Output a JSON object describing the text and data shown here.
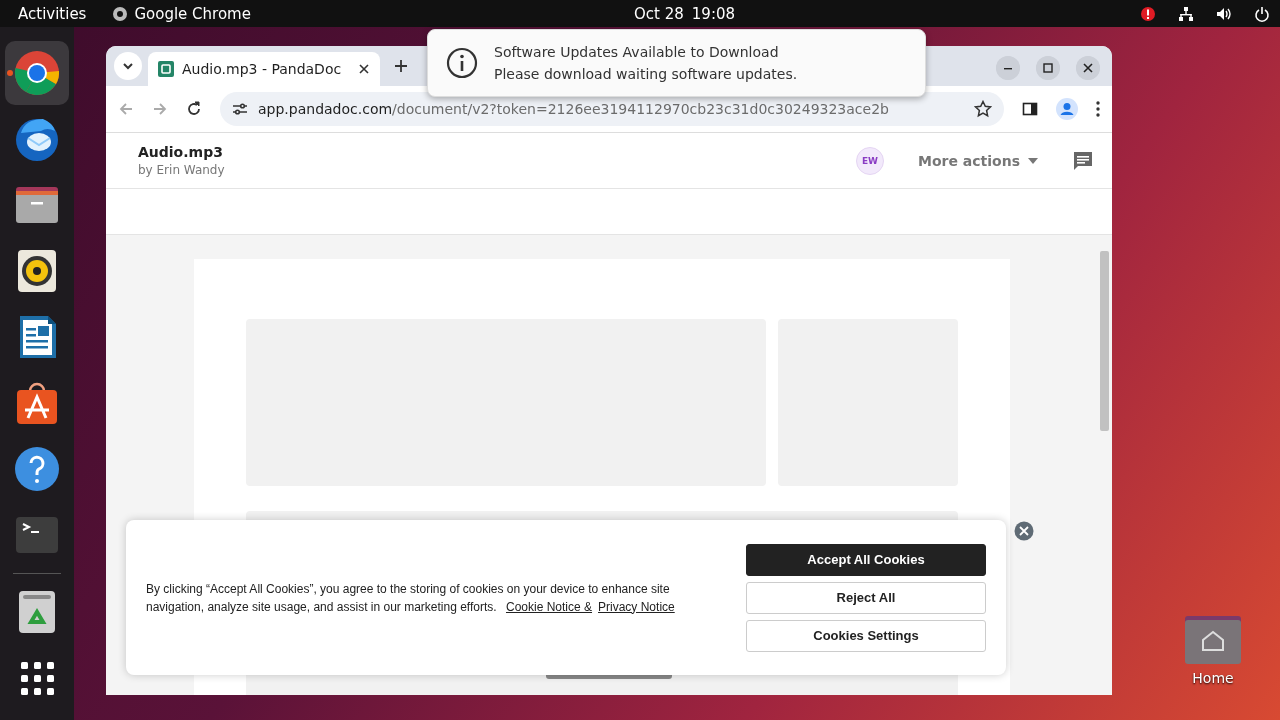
{
  "top_bar": {
    "activities": "Activities",
    "app": "Google Chrome",
    "date": "Oct 28",
    "time": "19:08"
  },
  "dock": {
    "items": [
      {
        "kind": "chrome",
        "selected": true
      },
      {
        "kind": "mail",
        "selected": false
      },
      {
        "kind": "files",
        "selected": false
      },
      {
        "kind": "music",
        "selected": false
      },
      {
        "kind": "writer",
        "selected": false
      },
      {
        "kind": "store",
        "selected": false
      },
      {
        "kind": "help",
        "selected": false
      },
      {
        "kind": "terminal",
        "selected": false
      },
      {
        "kind": "trash",
        "selected": false
      },
      {
        "kind": "apps",
        "selected": false
      }
    ]
  },
  "browser": {
    "tab": {
      "title": "Audio.mp3 - PandaDoc"
    },
    "address": {
      "host": "app.pandadoc.com",
      "path": "/document/v2?token=2126ee3194112970cb23c31d0c30249323ace2b"
    },
    "document": {
      "title": "Audio.mp3",
      "author": "by Erin Wandy",
      "avatar": "EW",
      "more_actions": "More actions"
    }
  },
  "notification": {
    "title": "Software Updates Available to Download",
    "body": "Please download waiting software updates."
  },
  "cookie_banner": {
    "text": "By clicking “Accept All Cookies”, you agree to the storing of cookies on your device to enhance site navigation, analyze site usage, and assist in our marketing efforts.",
    "links": [
      "Cookie Notice &",
      "Privacy Notice"
    ],
    "buttons": [
      {
        "label": "Accept All Cookies",
        "kind": "primary"
      },
      {
        "label": "Reject All",
        "kind": "secondary"
      },
      {
        "label": "Cookies Settings",
        "kind": "secondary"
      }
    ]
  },
  "desktop_icons": [
    {
      "label": "Home"
    }
  ]
}
